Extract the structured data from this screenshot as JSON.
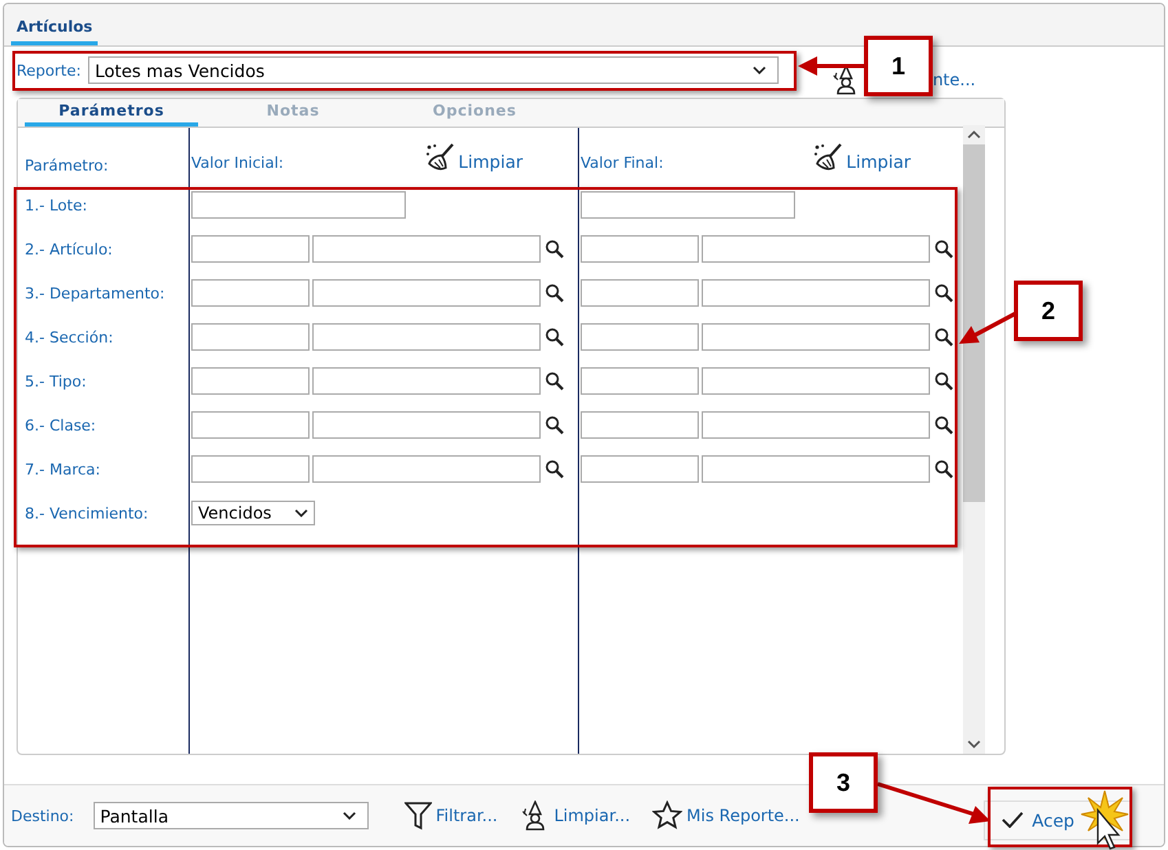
{
  "tabs": [
    {
      "label": "Artículos",
      "selected": true
    }
  ],
  "report": {
    "label": "Reporte:",
    "value": "Lotes mas Vencidos",
    "side_action": "nte..."
  },
  "panel_tabs": [
    {
      "label": "Parámetros",
      "selected": true
    },
    {
      "label": "Notas",
      "selected": false
    },
    {
      "label": "Opciones",
      "selected": false
    }
  ],
  "parameters": {
    "columns": [
      "Parámetro:",
      "Valor Inicial:",
      "Valor Final:"
    ],
    "clear_buttons": [
      "Limpiar",
      "Limpiar"
    ],
    "rows": [
      {
        "label": "1.- Lote:",
        "kind": "single"
      },
      {
        "label": "2.- Artículo:",
        "kind": "lookup"
      },
      {
        "label": "3.- Departamento:",
        "kind": "lookup"
      },
      {
        "label": "4.- Sección:",
        "kind": "lookup"
      },
      {
        "label": "5.- Tipo:",
        "kind": "lookup"
      },
      {
        "label": "6.- Clase:",
        "kind": "lookup"
      },
      {
        "label": "7.- Marca:",
        "kind": "lookup"
      },
      {
        "label": "8.- Vencimiento:",
        "kind": "select",
        "value": "Vencidos"
      }
    ]
  },
  "footer": {
    "destination_label": "Destino:",
    "destination": "Pantalla",
    "actions": [
      {
        "label": "Filtrar...",
        "kind": "filter"
      },
      {
        "label": "Limpiar...",
        "kind": "wizard"
      },
      {
        "label": "Mis Reporte...",
        "kind": "star"
      }
    ],
    "accept": "Acep"
  },
  "callouts": [
    {
      "label": "1"
    },
    {
      "label": "2"
    },
    {
      "label": "3"
    }
  ]
}
